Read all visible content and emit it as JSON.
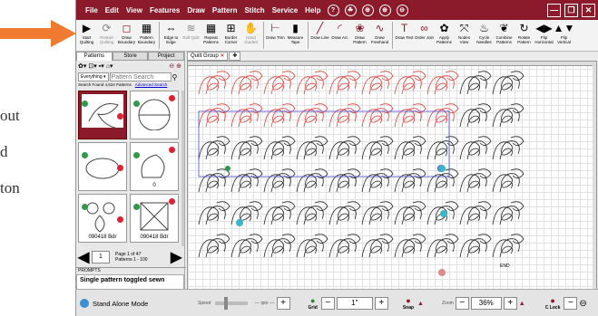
{
  "background_page": {
    "fragments": [
      "out",
      "d",
      "ton"
    ]
  },
  "menu": [
    "File",
    "Edit",
    "View",
    "Features",
    "Draw",
    "Pattern",
    "Stitch",
    "Service",
    "Help"
  ],
  "menu_icons": [
    "?",
    "☘",
    "⊕",
    "⊕",
    "⊖"
  ],
  "window_controls": [
    "—",
    "❐",
    "✕"
  ],
  "toolbar": [
    {
      "label": "Start Quilting",
      "icon": "▶",
      "enabled": true
    },
    {
      "label": "Restart Quilting",
      "icon": "⟳",
      "enabled": false
    },
    {
      "label": "Draw Boundary",
      "icon": "◻",
      "enabled": true
    },
    {
      "label": "Pattern Boundary",
      "icon": "▦",
      "enabled": true
    },
    {
      "label": "Edge to Edge",
      "icon": "⇔",
      "enabled": true
    },
    {
      "label": "Roll Quilt",
      "icon": "≋",
      "enabled": false
    },
    {
      "label": "Repeat Patterns",
      "icon": "▦",
      "enabled": true
    },
    {
      "label": "Border Corner",
      "icon": "⊞",
      "enabled": true
    },
    {
      "label": "Hand Guided",
      "icon": "✋",
      "enabled": false
    },
    {
      "label": "Draw Trim",
      "icon": "⊢",
      "enabled": true
    },
    {
      "label": "Measure Tape",
      "icon": "▮",
      "enabled": true
    },
    {
      "label": "Draw Line",
      "icon": "╱",
      "enabled": true
    },
    {
      "label": "Draw Arc",
      "icon": "◜",
      "enabled": true
    },
    {
      "label": "Draw Pattern",
      "icon": "❀",
      "enabled": true
    },
    {
      "label": "Draw Freehand",
      "icon": "∿",
      "enabled": true
    },
    {
      "label": "Draw Text",
      "icon": "T",
      "enabled": true
    },
    {
      "label": "Order Join",
      "icon": "∞",
      "enabled": true
    },
    {
      "label": "Apply Patterns",
      "icon": "✿",
      "enabled": true
    },
    {
      "label": "Nodes View",
      "icon": "⤧",
      "enabled": true
    },
    {
      "label": "Cycle Needles",
      "icon": "♨",
      "enabled": true
    },
    {
      "label": "Combine Patterns",
      "icon": "❦",
      "enabled": true
    },
    {
      "label": "Rotate Pattern",
      "icon": "↻",
      "enabled": true
    },
    {
      "label": "Flip Horizontal",
      "icon": "◀▶",
      "enabled": true
    },
    {
      "label": "Flip Vertical",
      "icon": "▲▼",
      "enabled": true
    }
  ],
  "panel": {
    "tabs": [
      "Patterns",
      "Store",
      "Project"
    ],
    "active_tab": "Patterns",
    "filter": "Everything",
    "search_placeholder": "Pattern Search",
    "found_text": "Search Found 4,634 Patterns",
    "advanced_link": "Advanced Search",
    "thumbs": [
      {
        "label": "",
        "selected": true
      },
      {
        "label": "",
        "selected": false
      },
      {
        "label": "",
        "selected": false
      },
      {
        "label": "0",
        "selected": false
      },
      {
        "label": "090418 Bdr",
        "selected": false
      },
      {
        "label": "090418 Bdr",
        "selected": false
      }
    ],
    "page_num": "1",
    "page_info": "Page 1 of 47",
    "page_range": "Patterns 1 - 100",
    "prompts_label": "PROMPTS",
    "prompt_message": "Single pattern toggled sewn"
  },
  "canvas": {
    "tab": "Quilt Group",
    "tab_close": "✕",
    "add_tab": "✚",
    "end_label": "END"
  },
  "status": {
    "mode": "Stand Alone Mode",
    "speed_label": "Speed",
    "ipm_label": "ipm",
    "grid_label": "Grid",
    "grid_value": "1\"",
    "snap_label": "Snap",
    "zoom_label": "Zoom",
    "zoom_value": "36%",
    "clock_label": "C Lock"
  },
  "colors": {
    "menubar": "#8b1a2b",
    "pattern_red": "#e0403a",
    "pattern_black": "#222222",
    "selection_blue": "#4a4acc",
    "arrow": "#f07a30"
  }
}
